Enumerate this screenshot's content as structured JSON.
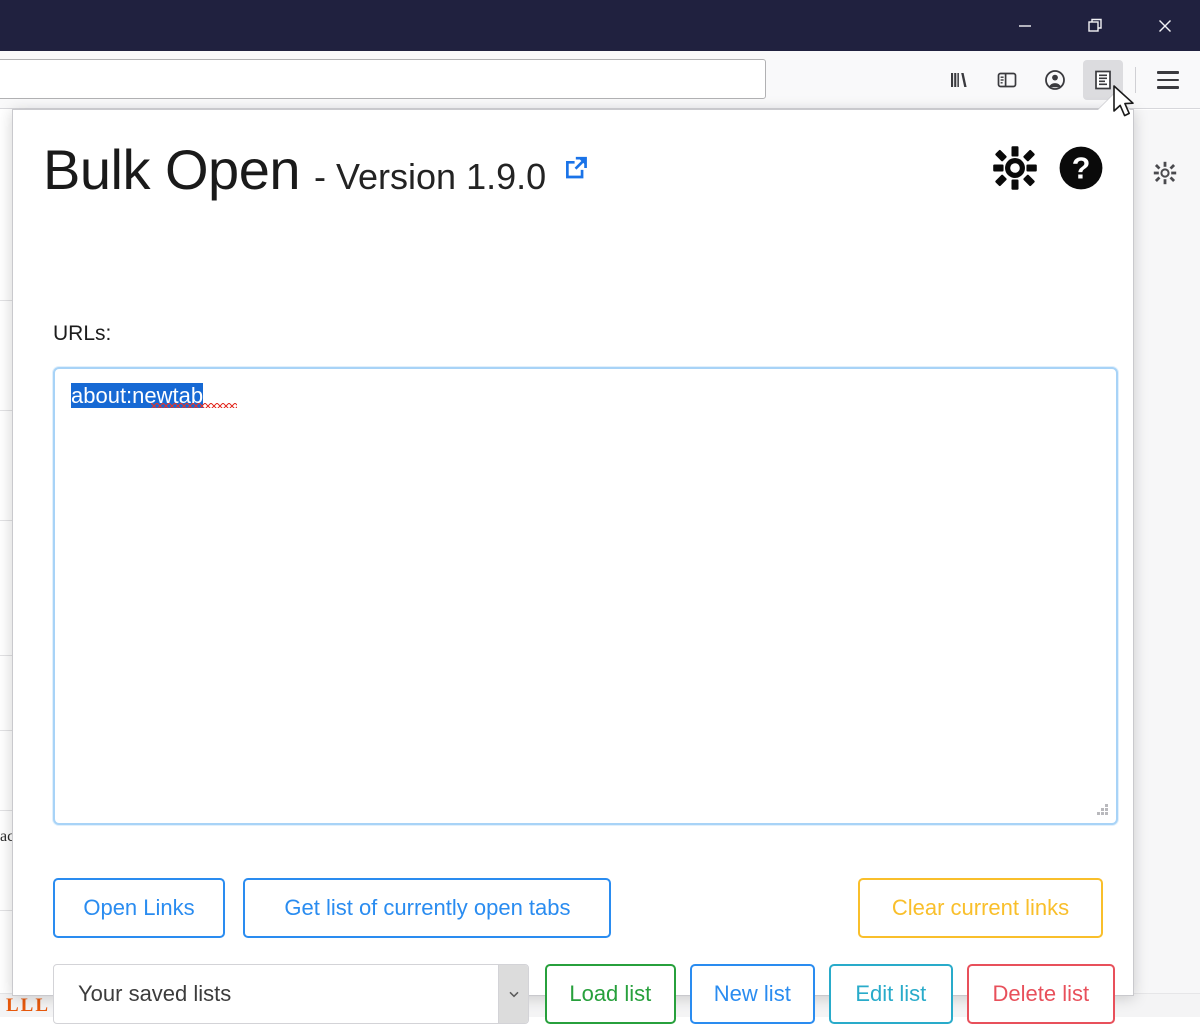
{
  "window": {
    "controls": [
      {
        "name": "minimize",
        "glyph": "minimize-icon"
      },
      {
        "name": "restore",
        "glyph": "restore-icon"
      },
      {
        "name": "close",
        "glyph": "close-icon"
      }
    ],
    "titlebar_color": "#20213f"
  },
  "navbar": {
    "url_value": "",
    "url_placeholder": "",
    "icons": [
      {
        "name": "library-icon",
        "label": "Library"
      },
      {
        "name": "sidebar-icon",
        "label": "Sidebars"
      },
      {
        "name": "account-icon",
        "label": "Account"
      },
      {
        "name": "bulk-open-extension-icon",
        "label": "Bulk Open",
        "active": true
      },
      {
        "name": "hamburger-menu-icon",
        "label": "Open application menu"
      }
    ]
  },
  "background_page": {
    "gear_icon": "gear-icon",
    "text_fragment": "ac",
    "orange_fragment": "LLL OL"
  },
  "popup": {
    "title": "Bulk Open",
    "version": "- Version 1.9.0",
    "external_link_icon": "external-link-icon",
    "settings_icon": "gear-icon",
    "help_icon": "help-circle-icon",
    "urls_label": "URLs:",
    "urls_value": "about:newtab",
    "urls_selected": true,
    "resize_handle": "resize-grip-icon",
    "actions": {
      "open_links": "Open Links",
      "get_tabs": "Get list of currently open tabs",
      "clear_links": "Clear current links"
    },
    "lists": {
      "select_label": "Your saved lists",
      "select_arrow": "chevron-down-icon",
      "load": "Load list",
      "new": "New list",
      "edit": "Edit list",
      "delete": "Delete list"
    },
    "colors": {
      "blue": "#2a8cf0",
      "yellow": "#f9bf2b",
      "green": "#27a03c",
      "teal": "#29abca",
      "red": "#e8505b",
      "selection": "#1669d4",
      "textarea_border": "#a8d3f7"
    }
  }
}
